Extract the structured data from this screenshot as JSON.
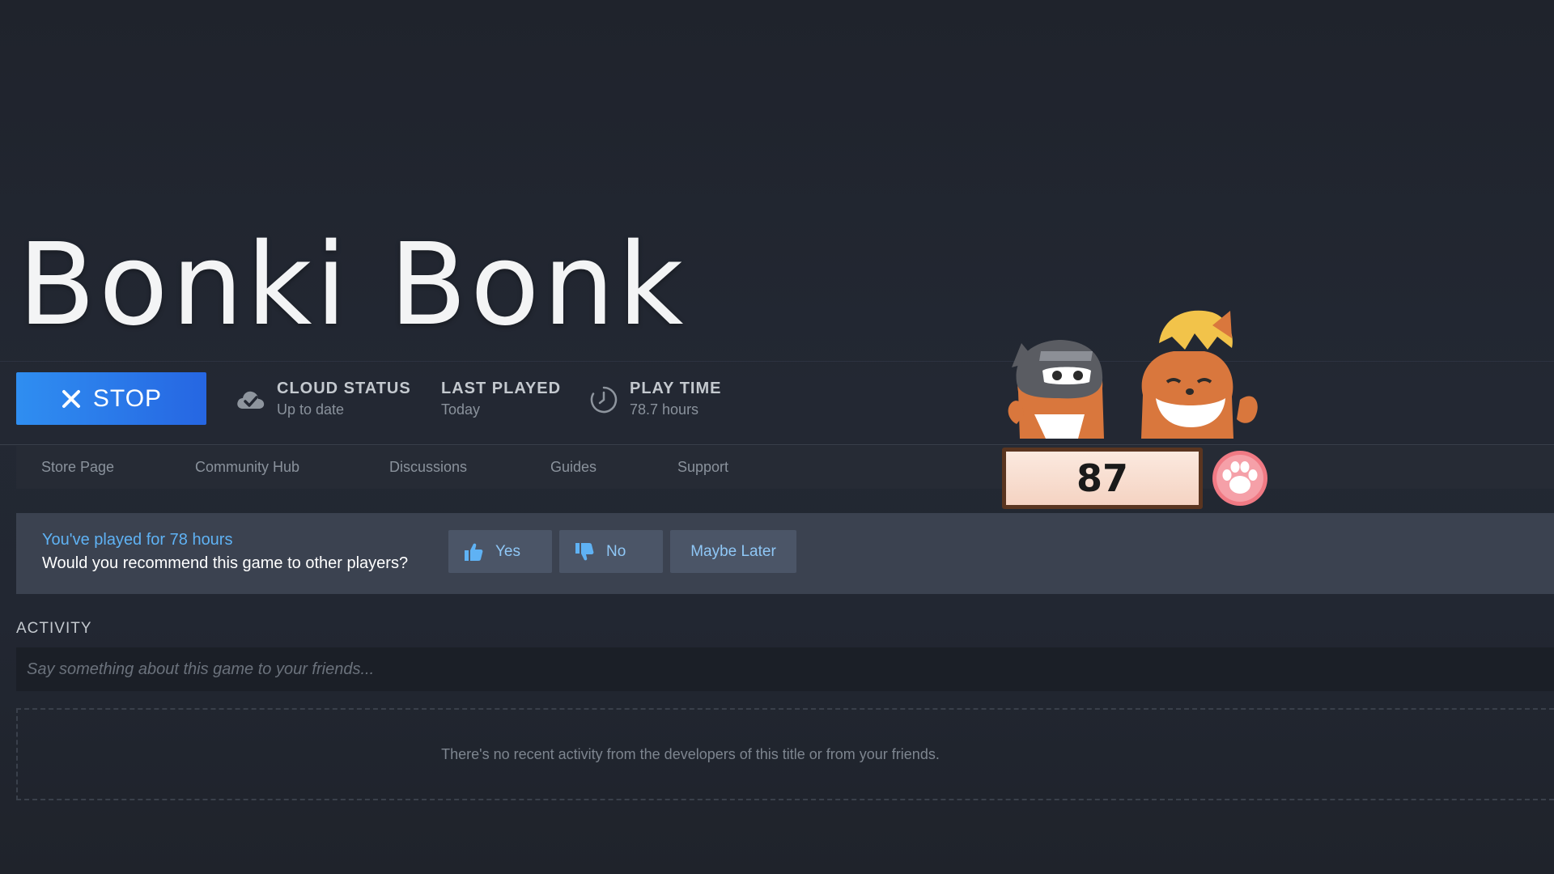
{
  "game": {
    "title": "Bonki Bonk"
  },
  "stats_bar": {
    "stop_label": "STOP",
    "cloud": {
      "label": "CLOUD STATUS",
      "value": "Up to date",
      "icon": "cloud-check-icon"
    },
    "last_played": {
      "label": "LAST PLAYED",
      "value": "Today"
    },
    "play_time": {
      "label": "PLAY TIME",
      "value": "78.7 hours",
      "icon": "clock-icon"
    }
  },
  "nav": {
    "items": [
      {
        "label": "Store Page"
      },
      {
        "label": "Community Hub"
      },
      {
        "label": "Discussions"
      },
      {
        "label": "Guides"
      },
      {
        "label": "Support"
      }
    ]
  },
  "review": {
    "played_text": "You've played for 78 hours",
    "question": "Would you recommend this game to other players?",
    "yes_label": "Yes",
    "no_label": "No",
    "maybe_label": "Maybe Later"
  },
  "activity": {
    "header": "ACTIVITY",
    "placeholder": "Say something about this game to your friends...",
    "empty_message": "There's no recent activity from the developers of this title or from your friends."
  },
  "overlay": {
    "counter_value": "87",
    "paw_icon": "paw-icon",
    "characters": [
      "ninja-dog-character",
      "shiba-dog-character"
    ]
  },
  "colors": {
    "accent_blue": "#2f8ef1",
    "link_blue": "#5fb2f4",
    "panel": "#3b4250",
    "background": "#232833"
  }
}
